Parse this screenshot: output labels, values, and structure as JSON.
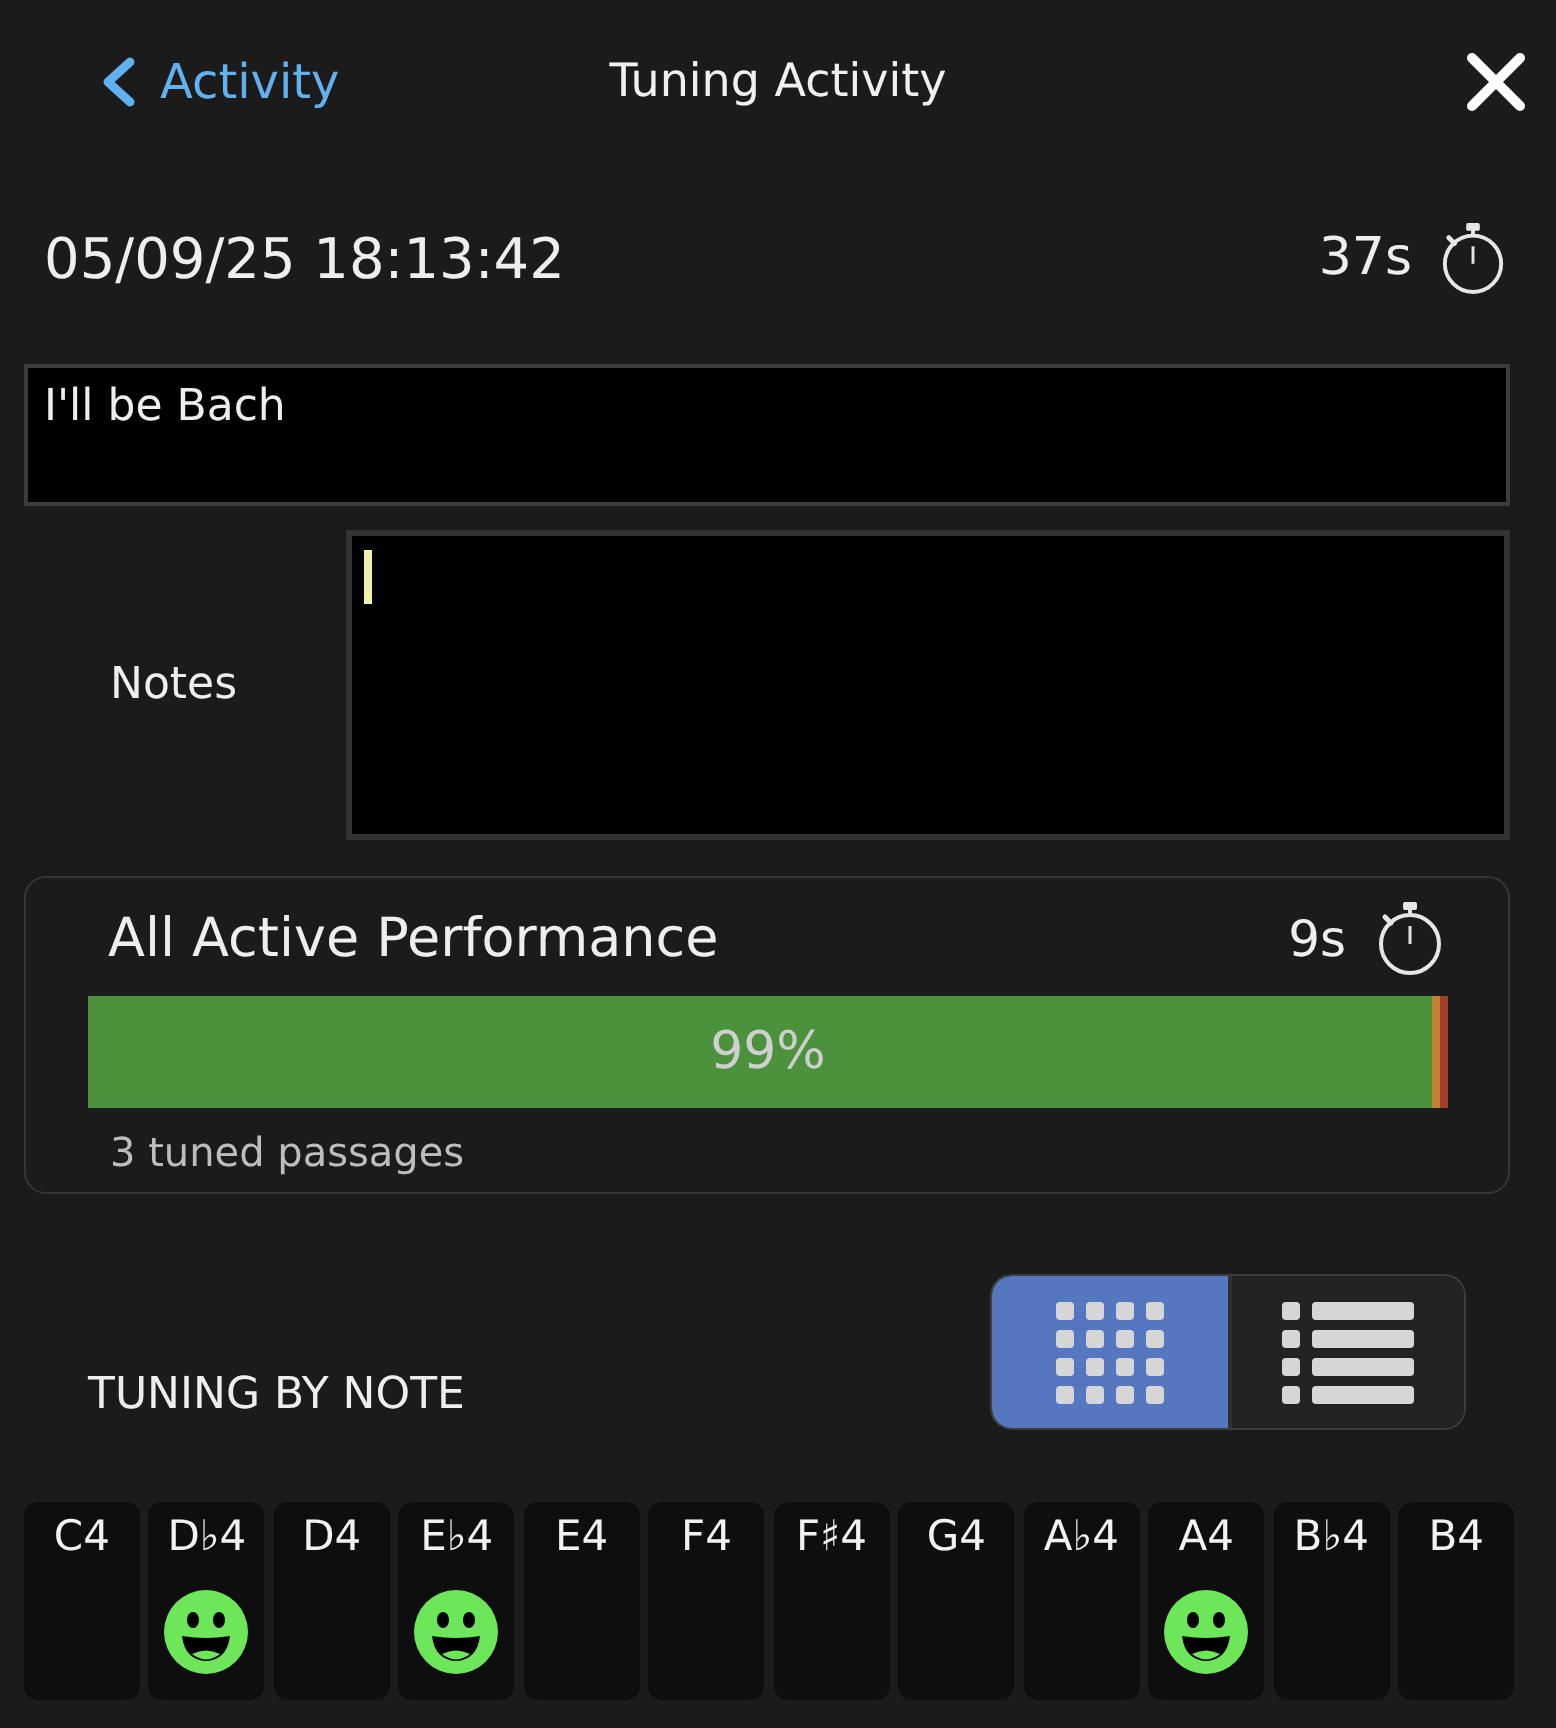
{
  "header": {
    "back_label": "Activity",
    "title": "Tuning Activity"
  },
  "session": {
    "timestamp": "05/09/25 18:13:42",
    "duration": "37s"
  },
  "title_field": {
    "value": "I'll be Bach"
  },
  "notes_field": {
    "label": "Notes",
    "focused": true
  },
  "performance": {
    "title": "All Active Performance",
    "duration": "9s",
    "reading": "99%",
    "segments": [
      {
        "color": "#4c923c",
        "level": 0.988
      },
      {
        "color": "#c0832f",
        "level": 0.006
      },
      {
        "color": "#a33d2e",
        "level": 0.006
      }
    ],
    "caption": "3 tuned passages"
  },
  "tuning_by_note": {
    "heading": "TUNING BY NOTE",
    "views": [
      {
        "kind": "grid",
        "selected": true
      },
      {
        "kind": "list",
        "selected": false
      }
    ],
    "notes": [
      {
        "label": "C4",
        "smiley": false
      },
      {
        "label": "D♭4",
        "smiley": true
      },
      {
        "label": "D4",
        "smiley": false
      },
      {
        "label": "E♭4",
        "smiley": true
      },
      {
        "label": "E4",
        "smiley": false
      },
      {
        "label": "F4",
        "smiley": false
      },
      {
        "label": "F♯4",
        "smiley": false
      },
      {
        "label": "G4",
        "smiley": false
      },
      {
        "label": "A♭4",
        "smiley": false
      },
      {
        "label": "A4",
        "smiley": true
      },
      {
        "label": "B♭4",
        "smiley": false
      },
      {
        "label": "B4",
        "smiley": false
      }
    ]
  }
}
